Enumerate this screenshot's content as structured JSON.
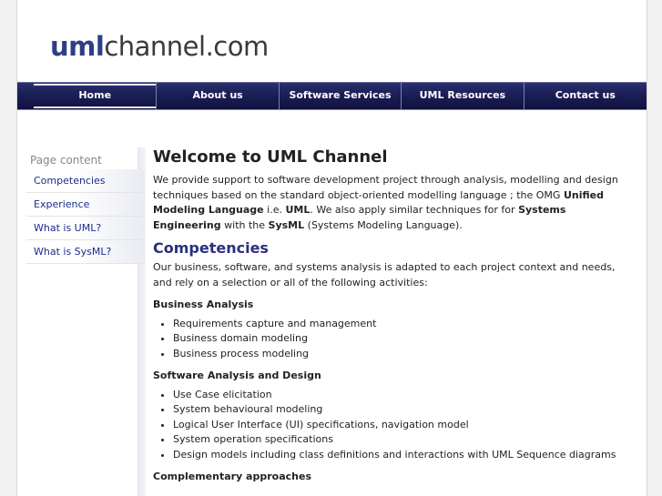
{
  "logo": {
    "uml": "uml",
    "rest": "channel.com"
  },
  "nav": [
    "Home",
    "About us",
    "Software Services",
    "UML Resources",
    "Contact us"
  ],
  "sidebar": {
    "title": "Page content",
    "items": [
      "Competencies",
      "Experience",
      "What is UML?",
      "What is SysML?"
    ]
  },
  "content": {
    "title": "Welcome to UML Channel",
    "intro": {
      "t1": "We provide support to software development project through analysis, modelling and design techniques based on the standard object-oriented modelling language ; the OMG ",
      "b1": "Unified Modeling Language",
      "t2": " i.e. ",
      "b2": "UML",
      "t3": ". We also apply similar techniques for for ",
      "b3": "Systems Engineering",
      "t4": " with the ",
      "b4": "SysML",
      "t5": " (Systems Modeling Language)."
    },
    "competencies_title": "Competencies",
    "competencies_text": "Our business, software, and systems analysis is adapted to each project context and needs, and rely on a selection or all of the following activities:",
    "business_title": "Business Analysis",
    "business_items": [
      "Requirements capture and management",
      "Business domain modeling",
      "Business process modeling"
    ],
    "software_title": "Software Analysis and Design",
    "software_items": [
      "Use Case elicitation",
      "System behavioural modeling",
      "Logical User Interface (UI) specifications, navigation model",
      "System operation specifications",
      "Design models including class definitions and interactions with UML Sequence diagrams"
    ],
    "complementary_title": "Complementary approaches"
  }
}
